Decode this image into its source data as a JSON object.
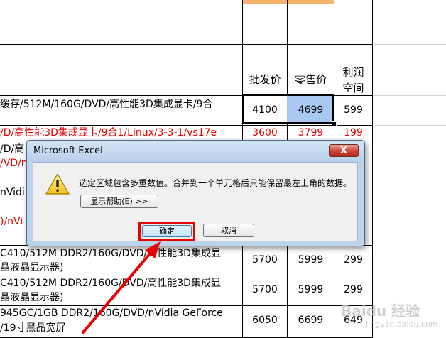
{
  "sheet": {
    "headers": {
      "wholesale": "批发价",
      "retail": "零售价",
      "profit_line1": "利润",
      "profit_line2": "空间"
    },
    "rows": [
      {
        "desc": "缓存/512M/160G/DVD/高性能3D集成显卡/9合",
        "wholesale": "4100",
        "retail": "4699",
        "profit": "599",
        "red": false
      },
      {
        "desc": "/D/高性能3D集成显卡/9合1/Linux/3-3-1/vs17e",
        "wholesale": "3600",
        "retail": "3799",
        "profit": "199",
        "red": true
      },
      {
        "desc": "/D/高",
        "red": false
      },
      {
        "desc": "/VD/n",
        "red": true
      },
      {
        "desc": "nVidi",
        "red": false
      },
      {
        "desc": ")/nVi",
        "red": true
      },
      {
        "desc": "C410/512M DDR2/160G/DVD/高性能3D集成显",
        "desc2": "晶液晶显示器)",
        "wholesale": "5700",
        "retail": "5999",
        "profit": "299",
        "red": false
      },
      {
        "desc": "C410/512M DDR2/160G/DVD/高性能3D集成显",
        "desc2": "晶液晶显示器)",
        "wholesale": "5700",
        "retail": "5999",
        "profit": "299",
        "red": false
      },
      {
        "desc": "945GC/1GB DDR2/160G/DVD/nVidia GeForce",
        "desc2": "/19寸黑晶宽屏",
        "wholesale": "6050",
        "retail": "6699",
        "profit": "649",
        "red": false
      }
    ]
  },
  "dialog": {
    "title": "Microsoft Excel",
    "close_label": "X",
    "message": "选定区域包含多重数值。合并到一个单元格后只能保留最左上角的数据。",
    "help_label": "显示帮助(E) >>",
    "ok_label": "确定",
    "cancel_label": "取消",
    "icon": "warning-icon"
  },
  "watermark": {
    "text": "Baidu 经验",
    "sub": "jingyan.baidu.com"
  },
  "colors": {
    "red_text": "#e60000",
    "selection": "#a9c9f3",
    "header_orange": "#f7b26b"
  }
}
